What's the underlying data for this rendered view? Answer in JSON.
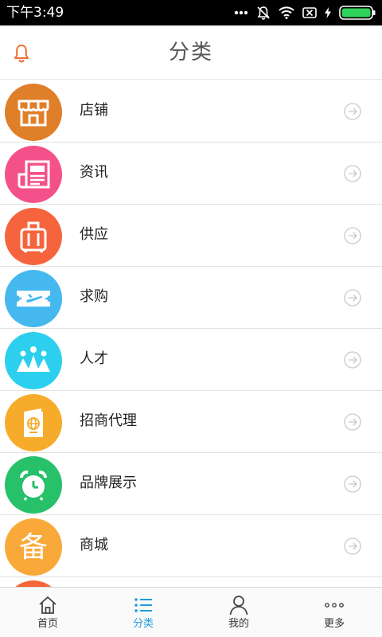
{
  "status_bar": {
    "time": "下午3:49",
    "icons": [
      "more-dots-icon",
      "mute-icon",
      "wifi-icon",
      "no-sim-icon",
      "charging-icon",
      "battery-icon"
    ]
  },
  "header": {
    "title": "分类",
    "left_icon": "bell-icon",
    "accent_color": "#f26b2e"
  },
  "categories": [
    {
      "label": "店铺",
      "icon": "storefront-icon",
      "color": "#e07f2a"
    },
    {
      "label": "资讯",
      "icon": "newspaper-icon",
      "color": "#f4518a"
    },
    {
      "label": "供应",
      "icon": "suitcase-icon",
      "color": "#f6643e"
    },
    {
      "label": "求购",
      "icon": "ticket-plane-icon",
      "color": "#45b8f0"
    },
    {
      "label": "人才",
      "icon": "crown-people-icon",
      "color": "#2cd0ee"
    },
    {
      "label": "招商代理",
      "icon": "passport-icon",
      "color": "#f6ac2a"
    },
    {
      "label": "品牌展示",
      "icon": "alarm-clock-icon",
      "color": "#27c16a"
    },
    {
      "label": "商城",
      "icon": "bei-character-icon",
      "glyph": "备",
      "color": "#f9a93a"
    }
  ],
  "tab_bar": {
    "active_color": "#1e9be0",
    "tabs": [
      {
        "label": "首页",
        "icon": "home-icon"
      },
      {
        "label": "分类",
        "icon": "list-icon",
        "active": true
      },
      {
        "label": "我的",
        "icon": "user-icon"
      },
      {
        "label": "更多",
        "icon": "more-icon"
      }
    ]
  }
}
